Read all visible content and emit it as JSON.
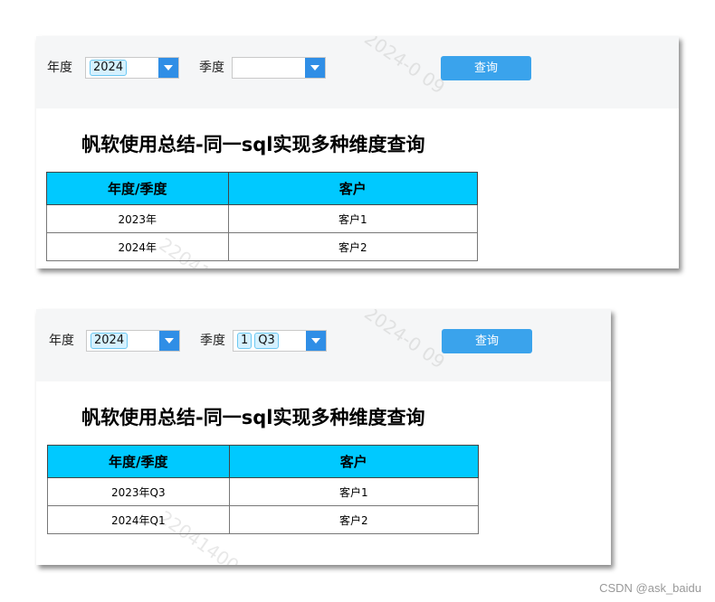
{
  "filters": {
    "year_label": "年度",
    "quarter_label": "季度",
    "query_label": "查询"
  },
  "panel1": {
    "year_tags": [
      "2024"
    ],
    "quarter_tags": [],
    "title": "帆软使用总结-同一sql实现多种维度查询",
    "headers": [
      "年度/季度",
      "客户"
    ],
    "rows": [
      [
        "2023年",
        "客户1"
      ],
      [
        "2024年",
        "客户2"
      ]
    ],
    "watermark_top": "2024-0 09",
    "watermark_bottom": "22041"
  },
  "panel2": {
    "year_tags": [
      "2024"
    ],
    "quarter_tags": [
      "1",
      "Q3"
    ],
    "title": "帆软使用总结-同一sql实现多种维度查询",
    "headers": [
      "年度/季度",
      "客户"
    ],
    "rows": [
      [
        "2023年Q3",
        "客户1"
      ],
      [
        "2024年Q1",
        "客户2"
      ]
    ],
    "watermark_top": "2024-0 09",
    "watermark_bottom": "220414004"
  },
  "footer": {
    "credit": "CSDN @ask_baidu"
  },
  "colors": {
    "header_fill": "#00c9ff",
    "button": "#3aa3ec",
    "combo_arrow": "#2f8ee6",
    "toolbar_bg": "#f5f6f7"
  },
  "icons": {
    "dropdown": "chevron-down-icon"
  }
}
